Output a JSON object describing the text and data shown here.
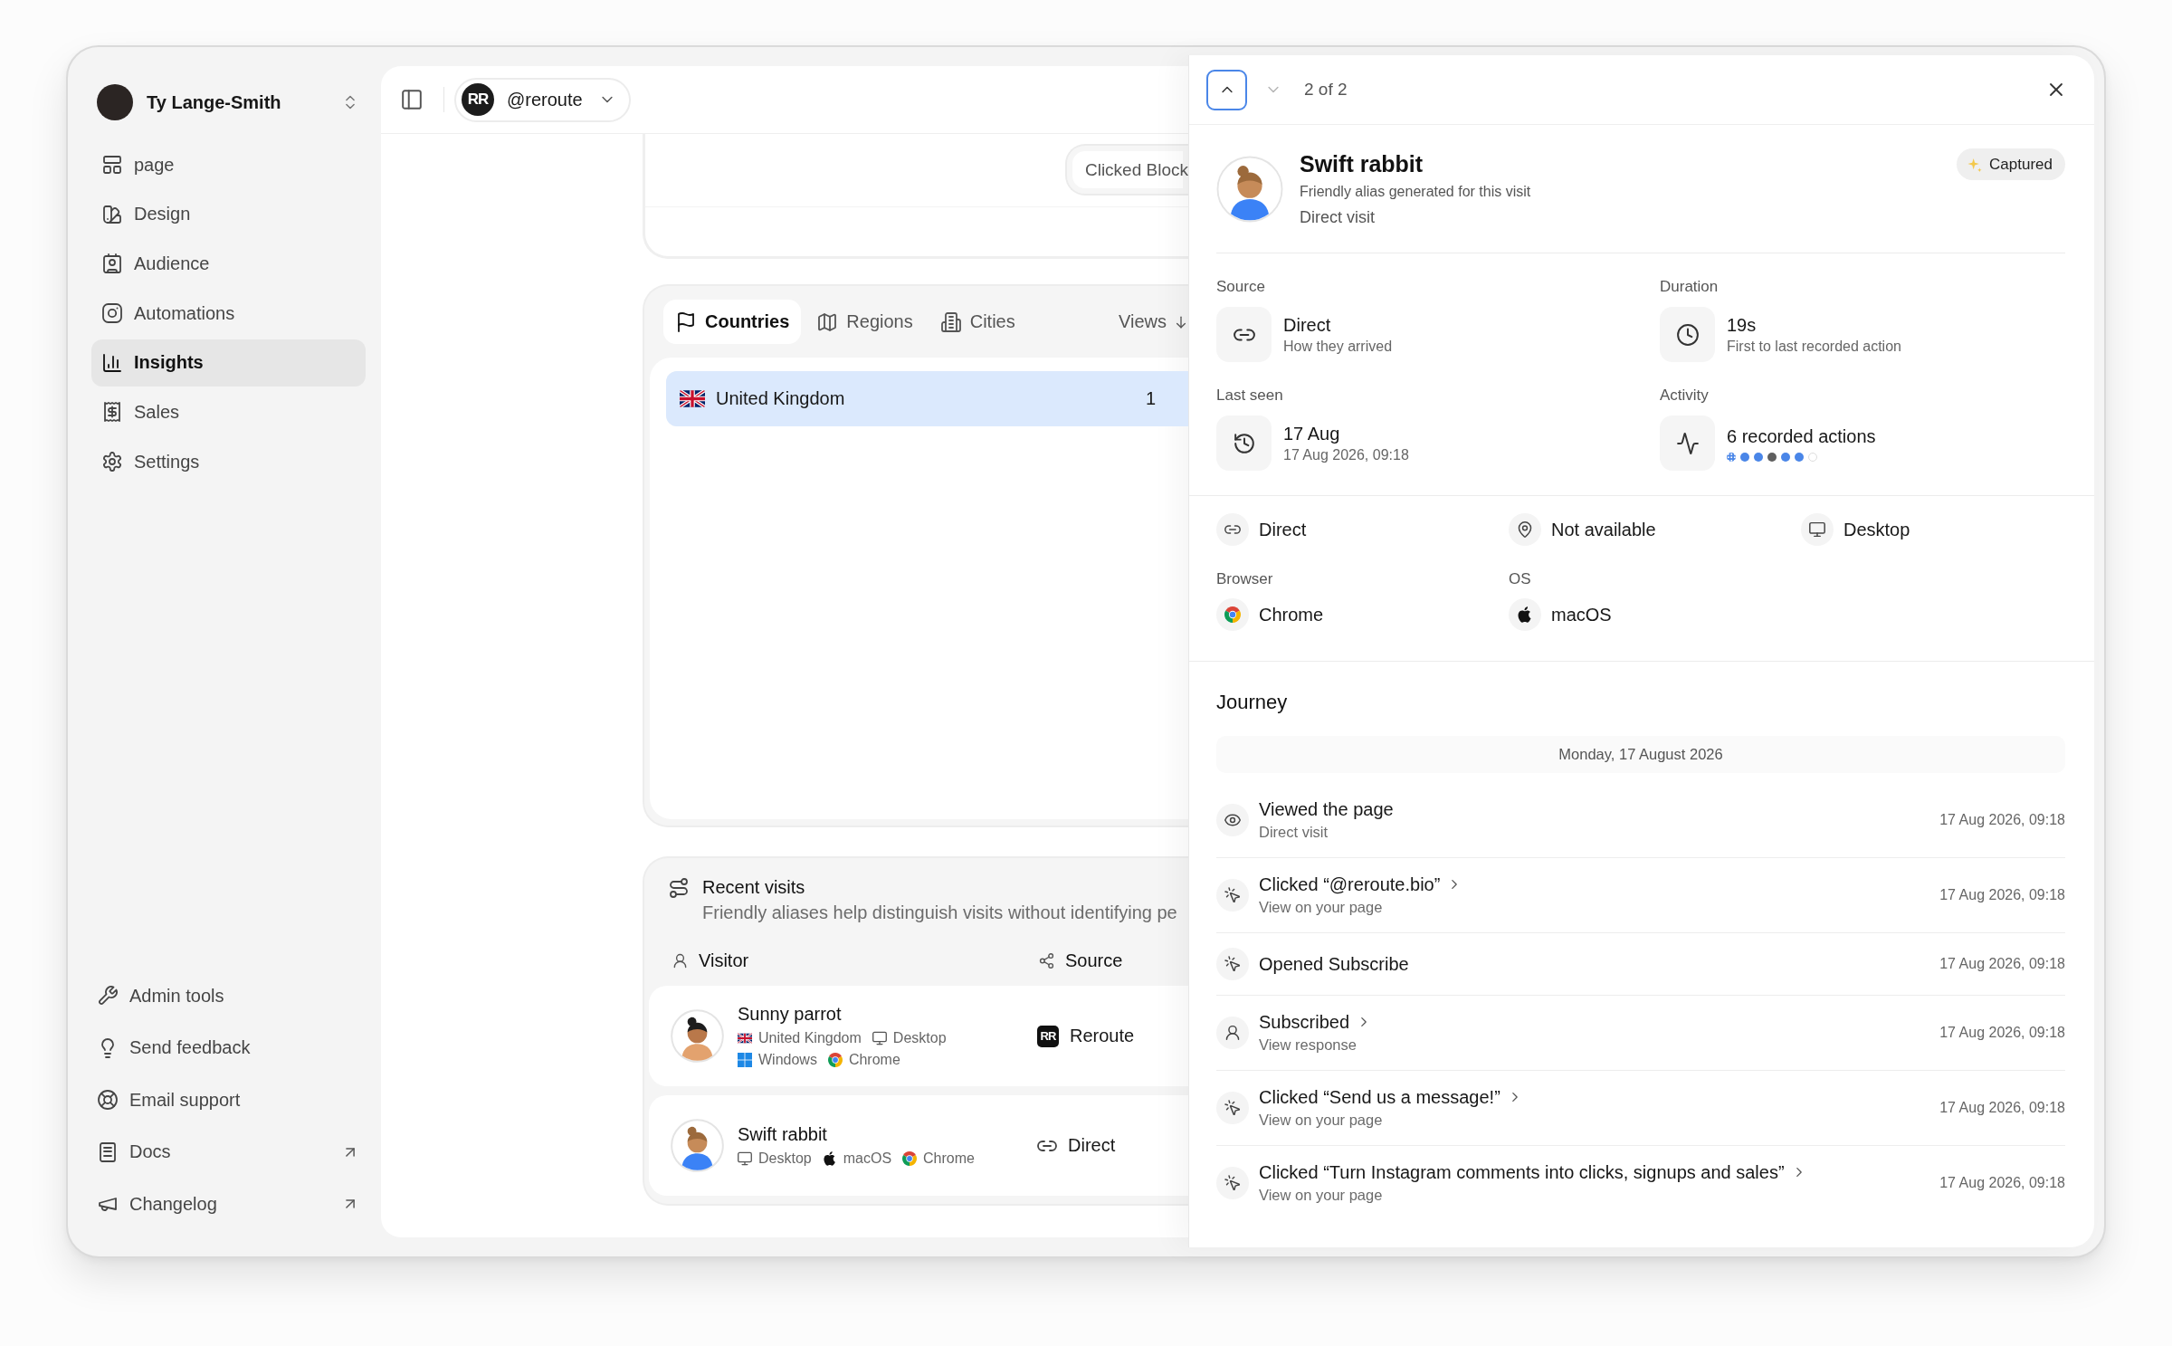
{
  "sidebar": {
    "account": {
      "name": "Ty Lange-Smith"
    },
    "nav": [
      {
        "label": "page",
        "selected": false
      },
      {
        "label": "Design",
        "selected": false
      },
      {
        "label": "Audience",
        "selected": false
      },
      {
        "label": "Automations",
        "selected": false
      },
      {
        "label": "Insights",
        "selected": true
      },
      {
        "label": "Sales",
        "selected": false
      },
      {
        "label": "Settings",
        "selected": false
      }
    ],
    "footer": [
      {
        "label": "Admin tools",
        "external": false
      },
      {
        "label": "Send feedback",
        "external": false
      },
      {
        "label": "Email support",
        "external": false
      },
      {
        "label": "Docs",
        "external": true
      },
      {
        "label": "Changelog",
        "external": true
      }
    ]
  },
  "topbar": {
    "account": {
      "logo": "RR",
      "handle": "@reroute"
    }
  },
  "event_card": {
    "chip": "Clicked Block"
  },
  "locations": {
    "tabs": [
      {
        "label": "Countries",
        "selected": true
      },
      {
        "label": "Regions",
        "selected": false
      },
      {
        "label": "Cities",
        "selected": false
      }
    ],
    "sort": "Views",
    "rows": [
      {
        "name": "United Kingdom",
        "value": "1",
        "level": 1
      }
    ]
  },
  "recent_visits": {
    "title": "Recent visits",
    "subtitle": "Friendly aliases help distinguish visits without identifying pe",
    "columns": [
      "Visitor",
      "Source"
    ],
    "rows": [
      {
        "name": "Sunny parrot",
        "meta": [
          "United Kingdom",
          "Desktop",
          "Windows",
          "Chrome"
        ],
        "source": {
          "logo": "RR",
          "label": "Reroute"
        }
      },
      {
        "name": "Swift rabbit",
        "meta": [
          "Desktop",
          "macOS",
          "Chrome"
        ],
        "source": {
          "label": "Direct"
        }
      }
    ]
  },
  "drawer": {
    "pager": {
      "position": "2 of 2",
      "buttons": [
        {
          "kind": "previous",
          "focused": true,
          "disabled": false
        },
        {
          "kind": "next",
          "focused": false,
          "disabled": true
        }
      ]
    },
    "visitor": {
      "name": "Swift rabbit",
      "note": "Friendly alias generated for this visit",
      "origin": "Direct visit",
      "badge": "Captured"
    },
    "stats": [
      {
        "label": "Source",
        "value": "Direct",
        "detail": "How they arrived"
      },
      {
        "label": "Duration",
        "value": "19s",
        "detail": "First to last recorded action"
      },
      {
        "label": "Last seen",
        "value": "17 Aug",
        "detail": "17 Aug 2026, 09:18"
      },
      {
        "label": "Activity",
        "value": "6 recorded actions",
        "dots": [
          {
            "kind": "pattern",
            "color": "#4a86e8"
          },
          {
            "kind": "filled",
            "color": "#4a86e8"
          },
          {
            "kind": "filled",
            "color": "#4a86e8"
          },
          {
            "kind": "filled",
            "color": "#5f5f5f"
          },
          {
            "kind": "filled",
            "color": "#4a86e8"
          },
          {
            "kind": "filled",
            "color": "#4a86e8"
          },
          {
            "kind": "hollow",
            "color": "#dddddd"
          }
        ]
      }
    ],
    "details": [
      {
        "value": "Direct"
      },
      {
        "value": "Not available"
      },
      {
        "value": "Desktop"
      },
      {
        "label": "Browser",
        "value": "Chrome"
      },
      {
        "label": "OS",
        "value": "macOS"
      }
    ],
    "journey": {
      "title": "Journey",
      "date": "Monday, 17 August 2026",
      "events": [
        {
          "kind": "view",
          "title": "Viewed the page",
          "detail": "Direct visit",
          "linked": false,
          "time": "17 Aug 2026, 09:18"
        },
        {
          "kind": "click",
          "title": "Clicked “@reroute.bio”",
          "detail": "View on your page",
          "linked": true,
          "time": "17 Aug 2026, 09:18"
        },
        {
          "kind": "click",
          "title": "Opened Subscribe",
          "linked": false,
          "time": "17 Aug 2026, 09:18"
        },
        {
          "kind": "subscribe",
          "title": "Subscribed",
          "detail": "View response",
          "linked": true,
          "time": "17 Aug 2026, 09:18"
        },
        {
          "kind": "click",
          "title": "Clicked “Send us a message!”",
          "detail": "View on your page",
          "linked": true,
          "time": "17 Aug 2026, 09:18"
        },
        {
          "kind": "click",
          "title": "Clicked “Turn Instagram comments into clicks, signups and sales”",
          "detail": "View on your page",
          "linked": true,
          "time": "17 Aug 2026, 09:18"
        }
      ]
    }
  }
}
